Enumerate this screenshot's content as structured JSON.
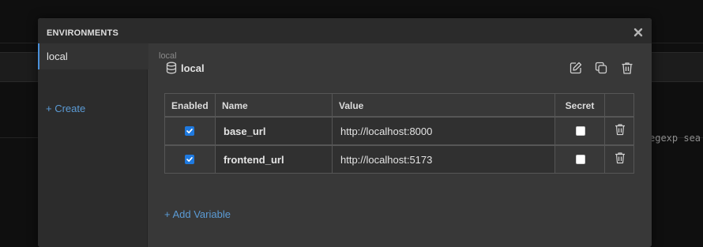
{
  "background": {
    "regex_text": "egexp sea"
  },
  "modal": {
    "title": "ENVIRONMENTS",
    "close_icon": "close-icon"
  },
  "sidebar": {
    "items": [
      {
        "label": "local",
        "selected": true
      }
    ],
    "create_label": "+ Create"
  },
  "environment": {
    "breadcrumb": "local",
    "name": "local",
    "icon": "database-icon",
    "actions": [
      "edit-icon",
      "duplicate-icon",
      "trash-icon"
    ]
  },
  "table": {
    "headers": {
      "enabled": "Enabled",
      "name": "Name",
      "value": "Value",
      "secret": "Secret"
    },
    "rows": [
      {
        "enabled": true,
        "name": "base_url",
        "value": "http://localhost:8000",
        "secret": false
      },
      {
        "enabled": true,
        "name": "frontend_url",
        "value": "http://localhost:5173",
        "secret": false
      }
    ]
  },
  "add_variable_label": "+ Add Variable",
  "colors": {
    "accent": "#5b9bd5",
    "checkbox_checked": "#1f7ae0",
    "modal_bg": "#383838"
  }
}
